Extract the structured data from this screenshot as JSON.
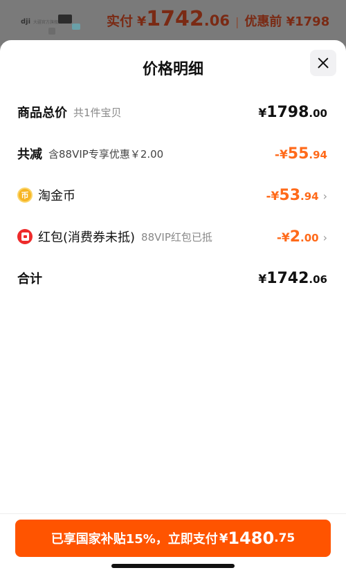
{
  "background": {
    "brand_logo": "dji",
    "store_text": "大疆官方旗舰店",
    "paid_label": "实付",
    "paid_yen": "¥",
    "paid_int": "1742",
    "paid_dec": ".06",
    "separator": "|",
    "original_price": "优惠前 ¥1798"
  },
  "sheet": {
    "title": "价格明细",
    "close_icon": "close-icon"
  },
  "rows": {
    "total": {
      "label": "商品总价",
      "note": "共1件宝贝",
      "yen": "¥",
      "int": "1798",
      "dec": ".00"
    },
    "discount": {
      "label": "共减",
      "note": "含88VIP专享优惠￥2.00",
      "yen": "-¥",
      "int": "55",
      "dec": ".94"
    },
    "coins": {
      "icon": "coin-icon",
      "icon_glyph": "币",
      "label": "淘金币",
      "yen": "-¥",
      "int": "53",
      "dec": ".94"
    },
    "redpacket": {
      "icon": "red-packet-icon",
      "label": "红包(消费券未抵)",
      "note": "88VIP红包已抵",
      "yen": "-¥",
      "int": "2",
      "dec": ".00"
    },
    "sum": {
      "label": "合计",
      "yen": "¥",
      "int": "1742",
      "dec": ".06"
    }
  },
  "footer": {
    "pay_text": "已享国家补贴15%，立即支付",
    "pay_yen": "¥",
    "pay_int": "1480",
    "pay_dec": ".75"
  },
  "colors": {
    "accent": "#ff5400",
    "discount_text": "#ff6a1a",
    "coin": "#f7b524",
    "red_packet": "#ee2b2b"
  }
}
